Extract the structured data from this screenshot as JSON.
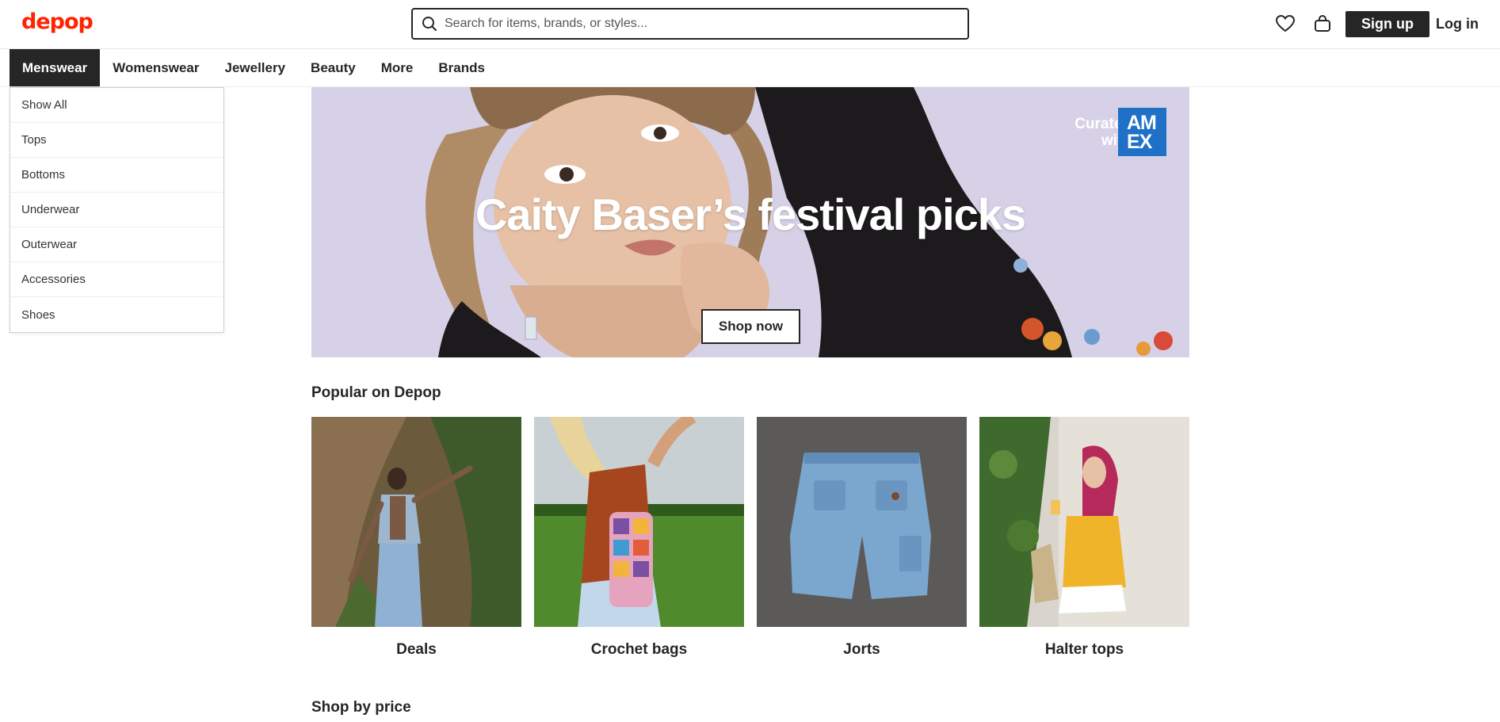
{
  "header": {
    "logo": "depop",
    "search_placeholder": "Search for items, brands, or styles...",
    "signup_label": "Sign up",
    "login_label": "Log in"
  },
  "nav": {
    "items": [
      {
        "label": "Menswear",
        "active": true
      },
      {
        "label": "Womenswear"
      },
      {
        "label": "Jewellery"
      },
      {
        "label": "Beauty"
      },
      {
        "label": "More"
      },
      {
        "label": "Brands"
      }
    ]
  },
  "dropdown": {
    "items": [
      "Show All",
      "Tops",
      "Bottoms",
      "Underwear",
      "Outerwear",
      "Accessories",
      "Shoes"
    ]
  },
  "hero": {
    "title": "Caity Baser’s festival picks",
    "cta": "Shop now",
    "curated_line1": "Curated",
    "curated_line2": "with",
    "amex_line1": "AM",
    "amex_line2": "EX"
  },
  "popular": {
    "title": "Popular on Depop",
    "tiles": [
      {
        "label": "Deals"
      },
      {
        "label": "Crochet bags"
      },
      {
        "label": "Jorts"
      },
      {
        "label": "Halter tops"
      }
    ]
  },
  "shop_by_price": {
    "title": "Shop by price"
  },
  "colors": {
    "brand": "#ff2300",
    "dark": "#262626",
    "amex": "#1f71c7"
  }
}
